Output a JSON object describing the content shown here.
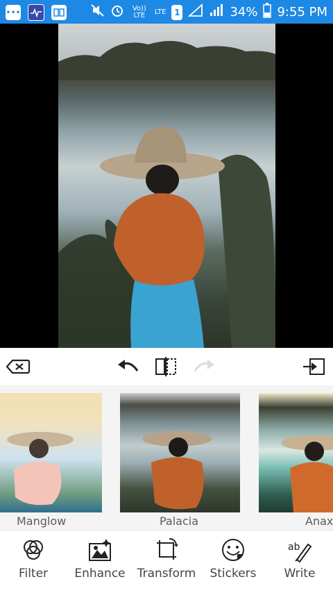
{
  "status_bar": {
    "volte_label": "Vo)) LTE",
    "lte_label": "LTE",
    "sim_label": "1",
    "battery": "34%",
    "time": "9:55 PM"
  },
  "filters": [
    {
      "label": "Manglow"
    },
    {
      "label": "Palacia"
    },
    {
      "label": "Anax"
    }
  ],
  "tabs": [
    {
      "label": "Filter",
      "icon": "filter-icon"
    },
    {
      "label": "Enhance",
      "icon": "enhance-icon"
    },
    {
      "label": "Transform",
      "icon": "transform-icon"
    },
    {
      "label": "Stickers",
      "icon": "sticker-icon"
    },
    {
      "label": "Write",
      "icon": "write-icon"
    }
  ],
  "colors": {
    "status_bar": "#1e88e5",
    "toolbar": "#ffffff",
    "filter_strip": "#f4f4f4"
  }
}
